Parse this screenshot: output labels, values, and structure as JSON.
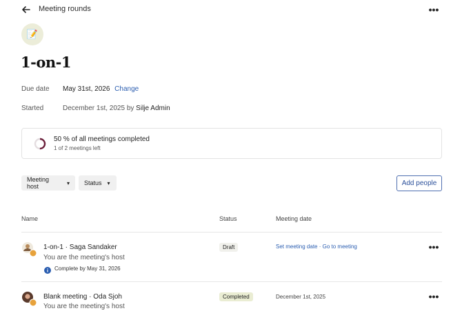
{
  "header": {
    "back_label": "←",
    "title": "Meeting rounds",
    "more_label": "•••"
  },
  "page": {
    "title": "1-on-1",
    "emoji": "📝"
  },
  "details": {
    "due_label": "Due date",
    "due_value": "May 31st, 2026",
    "due_change": "Change",
    "started_label": "Started",
    "started_value": "December 1st, 2025 by",
    "started_by": "Silje Admin"
  },
  "progress": {
    "title": "50 % of all meetings completed",
    "subtitle": "1 of 2 meetings left",
    "fraction": 0.5,
    "ring_color": "#6b1f3a"
  },
  "filters": {
    "host": "Meeting host",
    "status": "Status",
    "caret": "▾"
  },
  "actions": {
    "add_people": "Add people"
  },
  "table": {
    "headers": {
      "name": "Name",
      "status": "Status",
      "date": "Meeting date"
    },
    "rows": [
      {
        "name": "1-on-1 · Saga Sandaker",
        "sub": "You are the meeting's host",
        "note": "Complete by May 31, 2026",
        "note_icon": "info-icon",
        "status": "Draft",
        "status_bg": "#f1f1ec",
        "date_link1": "Set meeting date",
        "date_sep": "·",
        "date_link2": "Go to meeting",
        "more": "•••"
      },
      {
        "name": "Blank meeting · Oda Sjoh",
        "sub": "You are the meeting's host",
        "status": "Completed",
        "status_bg": "#eaedd3",
        "date": "December 1st, 2025",
        "more": "•••"
      }
    ]
  }
}
